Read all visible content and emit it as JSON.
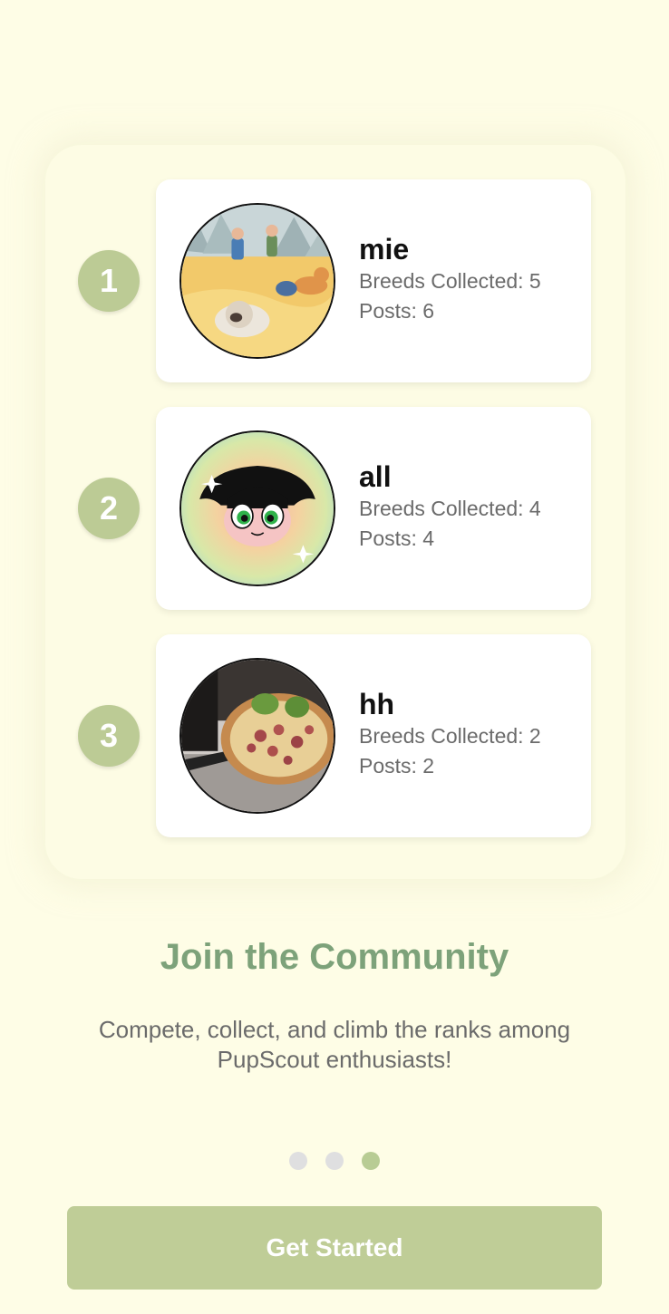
{
  "leaderboard": [
    {
      "rank": "1",
      "username": "mie",
      "breeds": "Breeds Collected: 5",
      "posts": "Posts: 6",
      "avatar_icon": "illustrated-hikers-with-dogs-avatar"
    },
    {
      "rank": "2",
      "username": "all",
      "breeds": "Breeds Collected: 4",
      "posts": "Posts: 4",
      "avatar_icon": "cartoon-girl-face-avatar"
    },
    {
      "rank": "3",
      "username": "hh",
      "breeds": "Breeds Collected: 2",
      "posts": "Posts: 2",
      "avatar_icon": "food-plate-photo-avatar"
    }
  ],
  "onboarding": {
    "heading": "Join the Community",
    "subtitle": "Compete, collect, and climb the ranks among PupScout enthusiasts!",
    "page_count": 3,
    "active_page": 3,
    "cta_label": "Get Started"
  },
  "colors": {
    "background": "#fefde6",
    "accent_green": "#7da27a",
    "badge_green": "#bccb95",
    "button_green": "#bfcd97"
  }
}
